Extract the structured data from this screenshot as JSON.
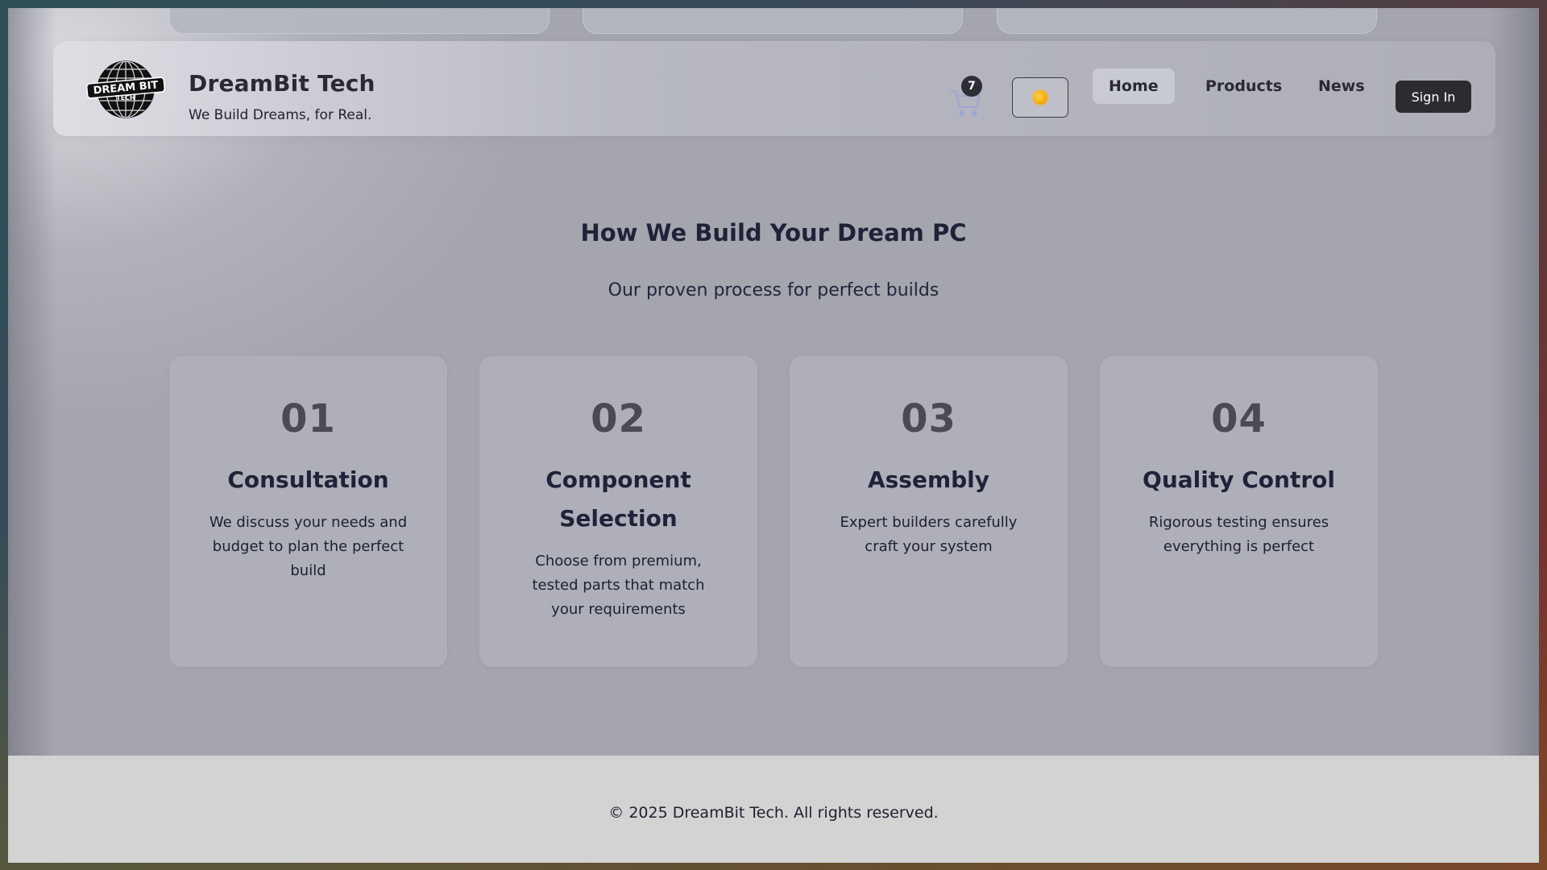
{
  "header": {
    "brand_title": "DreamBit Tech",
    "brand_tagline": "We Build Dreams, for Real.",
    "logo_text_top": "DREAM BIT",
    "logo_text_bottom": "TECH",
    "cart_count": "7",
    "theme_icon": "sun-icon",
    "nav": {
      "home": "Home",
      "products": "Products",
      "news": "News"
    },
    "signin_label": "Sign In"
  },
  "process": {
    "title": "How We Build Your Dream PC",
    "subtitle": "Our proven process for perfect builds",
    "steps": [
      {
        "number": "01",
        "title": "Consultation",
        "description": "We discuss your needs and budget to plan the perfect build"
      },
      {
        "number": "02",
        "title": "Component Selection",
        "description": "Choose from premium, tested parts that match your requirements"
      },
      {
        "number": "03",
        "title": "Assembly",
        "description": "Expert builders carefully craft your system"
      },
      {
        "number": "04",
        "title": "Quality Control",
        "description": "Rigorous testing ensures everything is perfect"
      }
    ]
  },
  "footer": {
    "copyright": "© 2025 DreamBit Tech. All rights reserved."
  },
  "colors": {
    "page_bg": "#a5a5ad",
    "heading": "#1e2338",
    "step_number": "#4a4a50",
    "signin_bg": "#2c2c30",
    "footer_bg": "#d3d3d3",
    "sun": "#f5a300"
  }
}
